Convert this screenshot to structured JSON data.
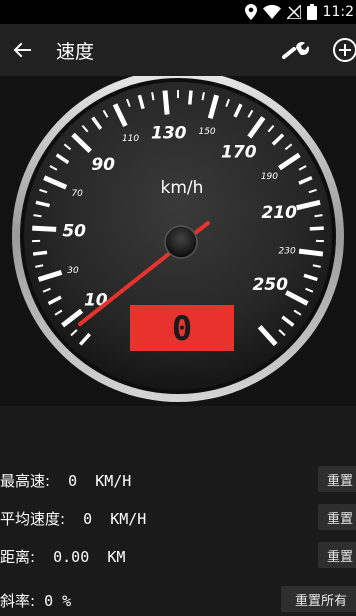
{
  "status_bar": {
    "time": "11:2"
  },
  "header": {
    "title": "速度"
  },
  "gauge": {
    "unit": "km/h",
    "major_labels": [
      "10",
      "50",
      "90",
      "130",
      "170",
      "210",
      "250"
    ],
    "minor_labels": [
      "30",
      "70",
      "110",
      "150",
      "190",
      "230"
    ],
    "digital_display": "0",
    "needle_color": "#e8322e",
    "display_color": "#e8322e"
  },
  "stats": {
    "max_speed": {
      "label": "最高速:",
      "value": "0",
      "unit": "KM/H",
      "button": "重置"
    },
    "avg_speed": {
      "label": "平均速度:",
      "value": "0",
      "unit": "KM/H",
      "button": "重置"
    },
    "distance": {
      "label": "距离:",
      "value": "0.00",
      "unit": "KM",
      "button": "重置"
    },
    "slope": {
      "label": "斜率:",
      "value": "0",
      "unit": "%",
      "button": "重置所有"
    }
  }
}
